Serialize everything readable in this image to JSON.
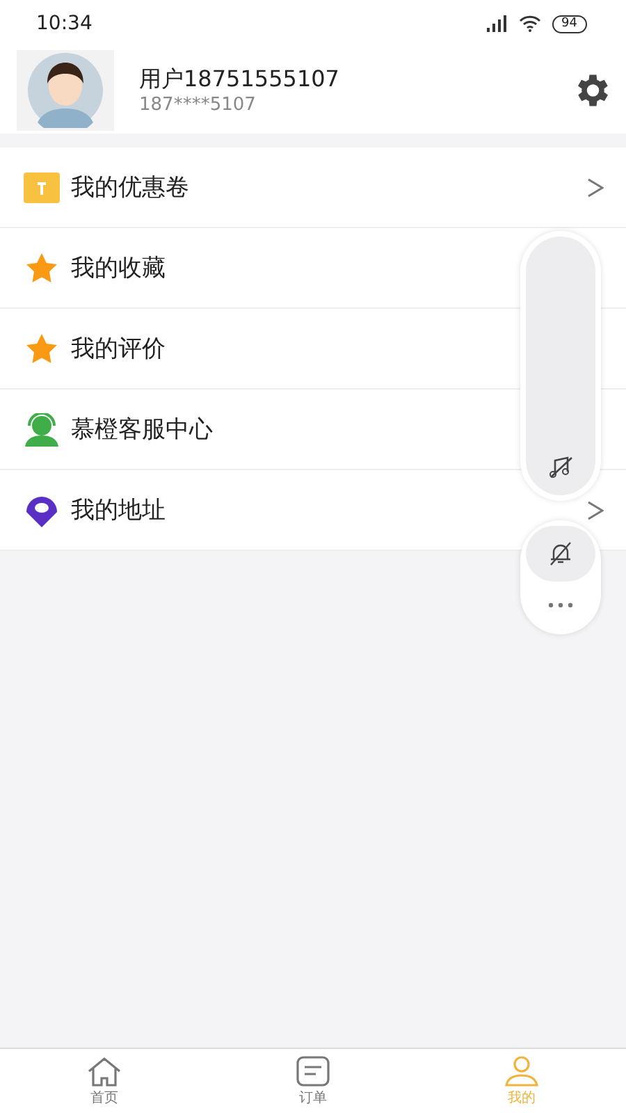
{
  "status_bar": {
    "time": "10:34",
    "battery": "94"
  },
  "profile": {
    "name": "用户18751555107",
    "phone": "187****5107"
  },
  "menu": [
    {
      "kind": "coupon",
      "label": "我的优惠卷",
      "chevron": true
    },
    {
      "kind": "star",
      "label": "我的收藏",
      "chevron": false
    },
    {
      "kind": "star",
      "label": "我的评价",
      "chevron": false
    },
    {
      "kind": "service",
      "label": "慕橙客服中心",
      "chevron": false
    },
    {
      "kind": "location",
      "label": "我的地址",
      "chevron": true
    }
  ],
  "tab_bar": [
    {
      "kind": "home",
      "label": "首页",
      "selected": false
    },
    {
      "kind": "orders",
      "label": "订单",
      "selected": false
    },
    {
      "kind": "profile",
      "label": "我的",
      "selected": true
    }
  ]
}
